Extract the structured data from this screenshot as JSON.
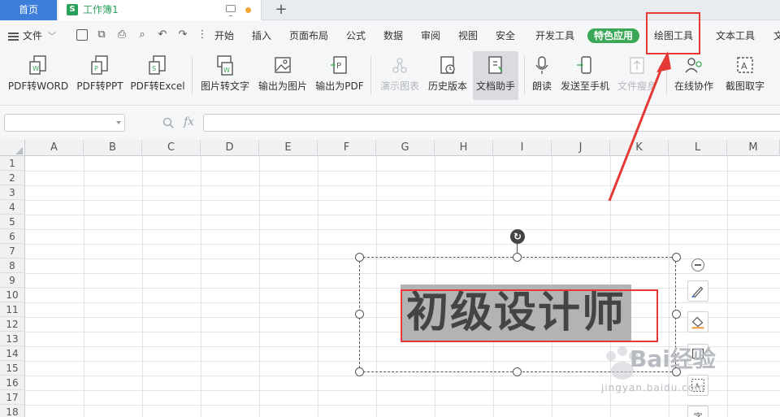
{
  "tabs": {
    "home": "首页",
    "doc_icon": "S",
    "doc": "工作簿1",
    "new": "+"
  },
  "menu": {
    "file": "文件",
    "items": [
      "开始",
      "插入",
      "页面布局",
      "公式",
      "数据",
      "审阅",
      "视图",
      "安全",
      "开发工具",
      "特色应用",
      "绘图工具",
      "文本工具",
      "文"
    ]
  },
  "ribbon": {
    "buttons": [
      {
        "label": "PDF转WORD",
        "icon": "pdf-to-word-icon",
        "disabled": false
      },
      {
        "label": "PDF转PPT",
        "icon": "pdf-to-ppt-icon",
        "disabled": false
      },
      {
        "label": "PDF转Excel",
        "icon": "pdf-to-excel-icon",
        "disabled": false
      },
      {
        "label": "图片转文字",
        "icon": "image-to-text-icon",
        "disabled": false
      },
      {
        "label": "输出为图片",
        "icon": "export-image-icon",
        "disabled": false
      },
      {
        "label": "输出为PDF",
        "icon": "export-pdf-icon",
        "disabled": false
      },
      {
        "label": "演示图表",
        "icon": "demo-chart-icon",
        "disabled": true
      },
      {
        "label": "历史版本",
        "icon": "history-icon",
        "disabled": false
      },
      {
        "label": "文档助手",
        "icon": "doc-assistant-icon",
        "disabled": false,
        "active": true
      },
      {
        "label": "朗读",
        "icon": "microphone-icon",
        "disabled": false
      },
      {
        "label": "发送至手机",
        "icon": "send-to-phone-icon",
        "disabled": false
      },
      {
        "label": "文件瘦身",
        "icon": "file-slim-icon",
        "disabled": true
      },
      {
        "label": "在线协作",
        "icon": "collaborate-icon",
        "disabled": false
      },
      {
        "label": "截图取字",
        "icon": "screenshot-text-icon",
        "disabled": false
      }
    ]
  },
  "formula": {
    "fx": "fx",
    "name_value": "",
    "formula_value": ""
  },
  "grid": {
    "columns": [
      "A",
      "B",
      "C",
      "D",
      "E",
      "F",
      "G",
      "H",
      "I",
      "J",
      "K",
      "L",
      "M"
    ],
    "rows": [
      "1",
      "2",
      "3",
      "4",
      "5",
      "6",
      "7",
      "8",
      "9",
      "10",
      "11",
      "12",
      "13",
      "14",
      "15",
      "16",
      "17",
      "18"
    ]
  },
  "textbox": {
    "text": "初级设计师"
  },
  "watermark": {
    "brand": "Bai",
    "brand2": "经验",
    "sub": "jingyan.baidu.com"
  },
  "colors": {
    "accent": "#3d7edb",
    "special": "#3aa857",
    "highlight": "#e53935"
  }
}
